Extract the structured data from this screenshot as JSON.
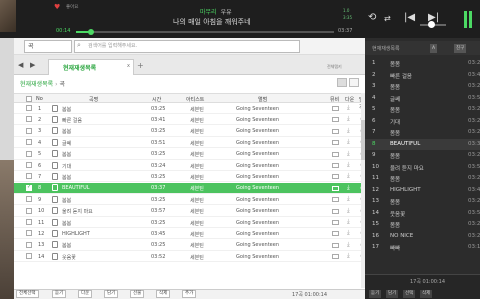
{
  "player": {
    "like_label": "좋아요",
    "artist": "마무리",
    "subtitle": "우유",
    "lyric": "나의 매일 아침을 깨워주네",
    "time_elapsed": "00:14",
    "time_total": "03:37",
    "progress": 0.06,
    "right_small_1": "1.0",
    "right_small_2": "3:35"
  },
  "search": {
    "select_value": "곡",
    "placeholder": "검색어를 입력해주세요."
  },
  "tabs": {
    "active_label": "현재재생목록",
    "close": "x",
    "add": "+",
    "all_label": "전체탭키"
  },
  "breadcrumb": {
    "root": "현재재생목록",
    "separator": "›",
    "current": "곡"
  },
  "table": {
    "headers": [
      "No",
      "곡명",
      "시간",
      "아티스트",
      "앨범",
      "뮤비",
      "다운",
      "담기"
    ],
    "rows": [
      {
        "no": "1",
        "title": "봄봄",
        "time": "03:25",
        "artist": "세븐틴",
        "album": "Going Seventeen"
      },
      {
        "no": "2",
        "title": "빠른 걸음",
        "time": "03:41",
        "artist": "세븐틴",
        "album": "Going Seventeen"
      },
      {
        "no": "3",
        "title": "봄봄",
        "time": "03:25",
        "artist": "세븐틴",
        "album": "Going Seventeen"
      },
      {
        "no": "4",
        "title": "글쎄",
        "time": "03:51",
        "artist": "세븐틴",
        "album": "Going Seventeen"
      },
      {
        "no": "5",
        "title": "봄봄",
        "time": "03:25",
        "artist": "세븐틴",
        "album": "Going Seventeen"
      },
      {
        "no": "6",
        "title": "기대",
        "time": "03:24",
        "artist": "세븐틴",
        "album": "Going Seventeen"
      },
      {
        "no": "7",
        "title": "봄봄",
        "time": "03:25",
        "artist": "세븐틴",
        "album": "Going Seventeen"
      },
      {
        "no": "8",
        "title": "BEAUTIFUL",
        "time": "03:37",
        "artist": "세븐틴",
        "album": "Going Seventeen"
      },
      {
        "no": "9",
        "title": "봄봄",
        "time": "03:25",
        "artist": "세븐틴",
        "album": "Going Seventeen"
      },
      {
        "no": "10",
        "title": "울려 듣지 마요",
        "time": "03:57",
        "artist": "세븐틴",
        "album": "Going Seventeen"
      },
      {
        "no": "11",
        "title": "봄봄",
        "time": "03:25",
        "artist": "세븐틴",
        "album": "Going Seventeen"
      },
      {
        "no": "12",
        "title": "HIGHLIGHT",
        "time": "03:45",
        "artist": "세븐틴",
        "album": "Going Seventeen"
      },
      {
        "no": "13",
        "title": "봄봄",
        "time": "03:25",
        "artist": "세븐틴",
        "album": "Going Seventeen"
      },
      {
        "no": "14",
        "title": "웃음꽃",
        "time": "03:52",
        "artist": "세븐틴",
        "album": "Going Seventeen"
      }
    ]
  },
  "bottom": {
    "buttons": [
      "전체선택",
      "듣기",
      "다운",
      "담기",
      "선물",
      "삭제",
      "추가"
    ],
    "count": "17곡 01:00:14"
  },
  "side": {
    "title": "현재재생목록",
    "btn_a": "A",
    "btn_b": "친구",
    "items": [
      {
        "no": "1",
        "title": "봄봄",
        "dur": "03:2"
      },
      {
        "no": "2",
        "title": "빠른 걸음",
        "dur": "03:4"
      },
      {
        "no": "3",
        "title": "봄봄",
        "dur": "03:2"
      },
      {
        "no": "4",
        "title": "글쎄",
        "dur": "03:5"
      },
      {
        "no": "5",
        "title": "봄봄",
        "dur": "03:2"
      },
      {
        "no": "6",
        "title": "기대",
        "dur": "03:2"
      },
      {
        "no": "7",
        "title": "봄봄",
        "dur": "03:2"
      },
      {
        "no": "8",
        "title": "BEAUTIFUL",
        "dur": "03:3"
      },
      {
        "no": "9",
        "title": "봄봄",
        "dur": "03:2"
      },
      {
        "no": "10",
        "title": "울려 듣지 마요",
        "dur": "03:5"
      },
      {
        "no": "11",
        "title": "봄봄",
        "dur": "03:2"
      },
      {
        "no": "12",
        "title": "HIGHLIGHT",
        "dur": "03:4"
      },
      {
        "no": "13",
        "title": "봄봄",
        "dur": "03:2"
      },
      {
        "no": "14",
        "title": "웃음꽃",
        "dur": "03:5"
      },
      {
        "no": "15",
        "title": "봄봄",
        "dur": "03:2"
      },
      {
        "no": "16",
        "title": "NO NICE",
        "dur": "03:2"
      },
      {
        "no": "17",
        "title": "빠빠",
        "dur": "03:1"
      }
    ],
    "count": "17곡 01:00:14",
    "foot_buttons": [
      "듣기",
      "담기",
      "선택",
      "삭제"
    ]
  }
}
